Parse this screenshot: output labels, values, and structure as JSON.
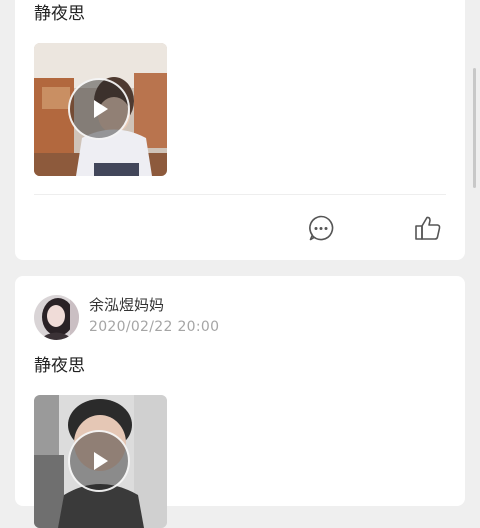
{
  "feed": {
    "posts": [
      {
        "text": "静夜思",
        "media": {
          "type": "video",
          "icon": "play-icon"
        },
        "actions": {
          "comment_icon": "comment-icon",
          "like_icon": "thumbs-up-icon"
        }
      },
      {
        "author": "余泓煜妈妈",
        "timestamp": "2020/02/22 20:00",
        "text": "静夜思",
        "media": {
          "type": "video",
          "icon": "play-icon"
        }
      }
    ]
  },
  "colors": {
    "background": "#efefef",
    "card": "#ffffff",
    "text": "#222222",
    "meta": "#a5a5a5",
    "icon": "#555555"
  }
}
